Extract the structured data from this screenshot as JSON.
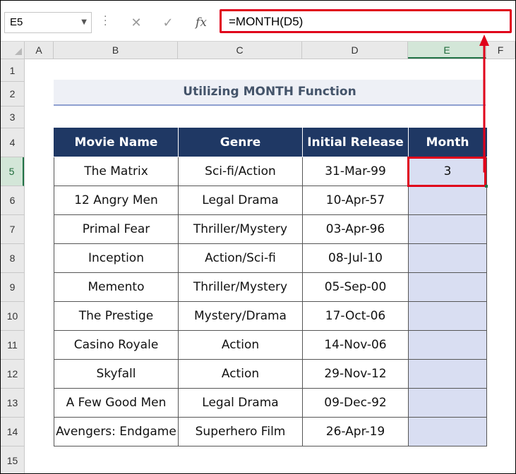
{
  "name_box": "E5",
  "formula_bar": {
    "cancel_icon": "✕",
    "enter_icon": "✓",
    "fx_icon": "fx",
    "formula": "=MONTH(D5)"
  },
  "columns": [
    "A",
    "B",
    "C",
    "D",
    "E",
    "F"
  ],
  "rows": [
    "1",
    "2",
    "3",
    "4",
    "5",
    "6",
    "7",
    "8",
    "9",
    "10",
    "11",
    "12",
    "13",
    "14",
    "15"
  ],
  "title": "Utilizing MONTH Function",
  "table": {
    "headers": [
      "Movie Name",
      "Genre",
      "Initial Release",
      "Month"
    ],
    "rows": [
      {
        "movie": "The Matrix",
        "genre": "Sci-fi/Action",
        "release": "31-Mar-99",
        "month": "3"
      },
      {
        "movie": "12 Angry Men",
        "genre": "Legal Drama",
        "release": "10-Apr-57",
        "month": ""
      },
      {
        "movie": "Primal Fear",
        "genre": "Thriller/Mystery",
        "release": "03-Apr-96",
        "month": ""
      },
      {
        "movie": "Inception",
        "genre": "Action/Sci-fi",
        "release": "08-Jul-10",
        "month": ""
      },
      {
        "movie": "Memento",
        "genre": "Thriller/Mystery",
        "release": "05-Sep-00",
        "month": ""
      },
      {
        "movie": "The Prestige",
        "genre": "Mystery/Drama",
        "release": "17-Oct-06",
        "month": ""
      },
      {
        "movie": "Casino Royale",
        "genre": "Action",
        "release": "14-Nov-06",
        "month": ""
      },
      {
        "movie": "Skyfall",
        "genre": "Action",
        "release": "29-Nov-12",
        "month": ""
      },
      {
        "movie": "A Few Good Men",
        "genre": "Legal Drama",
        "release": "09-Dec-92",
        "month": ""
      },
      {
        "movie": "Avengers: Endgame",
        "genre": "Superhero Film",
        "release": "26-Apr-19",
        "month": ""
      }
    ]
  },
  "colors": {
    "header_fill": "#1f3864",
    "month_fill": "#d9def2",
    "annotation_red": "#e0001b",
    "selection_green": "#217346"
  }
}
